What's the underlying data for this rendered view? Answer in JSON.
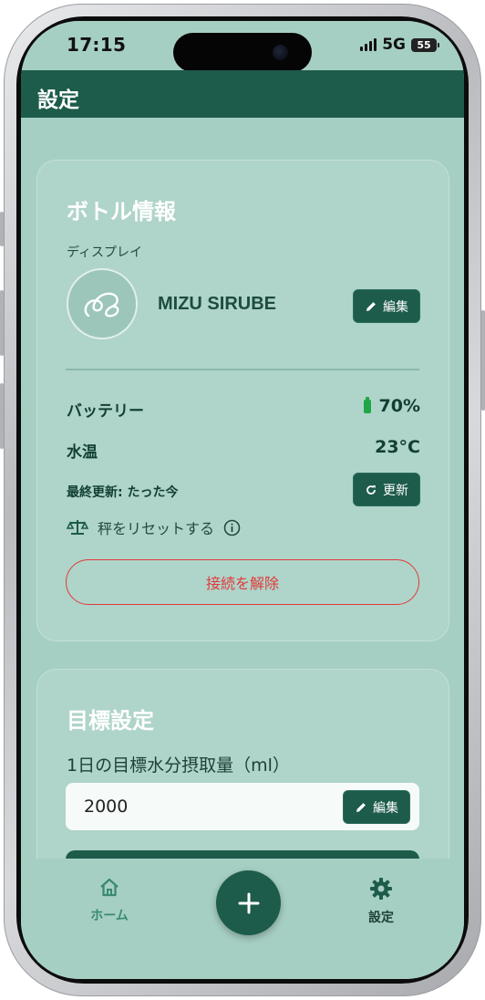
{
  "status_bar": {
    "time": "17:15",
    "network": "5G",
    "battery_level": "55"
  },
  "header": {
    "title": "設定"
  },
  "bottle_card": {
    "title": "ボトル情報",
    "display_label": "ディスプレイ",
    "device_name": "MIZU SIRUBE",
    "edit_label": "編集",
    "battery_label": "バッテリー",
    "battery_value": "70%",
    "water_temp_label": "水温",
    "water_temp_value": "23°C",
    "last_updated": "最終更新: たった今",
    "refresh_label": "更新",
    "reset_scale_label": "秤をリセットする",
    "disconnect_label": "接続を解除"
  },
  "goal_card": {
    "title": "目標設定",
    "daily_goal_label": "1日の目標水分摂取量（ml）",
    "daily_goal_value": "2000",
    "edit_label": "編集"
  },
  "nav": {
    "home_label": "ホーム",
    "settings_label": "設定"
  },
  "colors": {
    "primary": "#1d5b4b",
    "background": "#a6cfc3",
    "card": "#afd4c9",
    "danger": "#e23a3a",
    "battery_ok": "#1fa647",
    "nav_home": "#3a8a73"
  },
  "icons": [
    "pencil-icon",
    "battery-icon",
    "refresh-icon",
    "scale-icon",
    "info-icon",
    "home-icon",
    "plus-icon",
    "gear-icon"
  ]
}
